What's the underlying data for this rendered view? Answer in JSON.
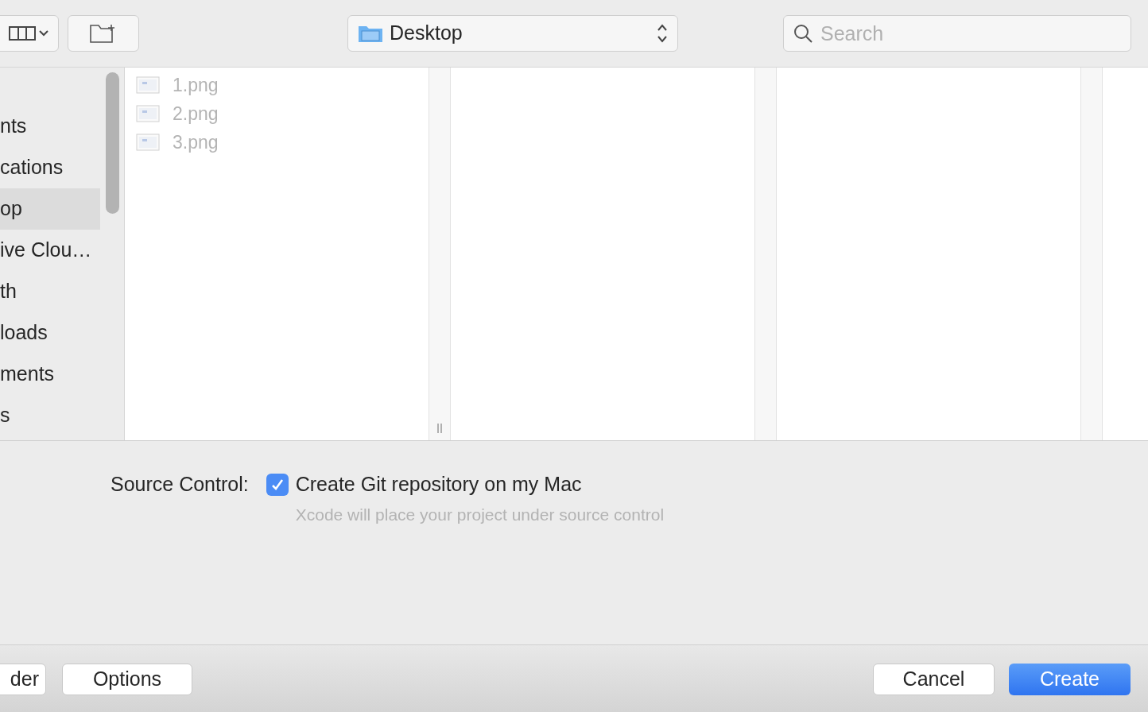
{
  "toolbar": {
    "location": "Desktop",
    "search": {
      "placeholder": "Search"
    }
  },
  "sidebar": {
    "items": [
      {
        "label": "nts",
        "selected": false
      },
      {
        "label": "cations",
        "selected": false
      },
      {
        "label": "op",
        "selected": true
      },
      {
        "label": "ive Clou…",
        "selected": false
      },
      {
        "label": "th",
        "selected": false
      },
      {
        "label": "loads",
        "selected": false
      },
      {
        "label": "ments",
        "selected": false
      },
      {
        "label": "s",
        "selected": false
      }
    ]
  },
  "files": [
    {
      "name": "1.png",
      "disabled": true
    },
    {
      "name": "2.png",
      "disabled": true
    },
    {
      "name": "3.png",
      "disabled": true
    }
  ],
  "source_control": {
    "label": "Source Control:",
    "checkbox": {
      "label": "Create Git repository on my Mac",
      "checked": true
    },
    "hint": "Xcode will place your project under source control"
  },
  "footer": {
    "left_buttons": [
      "der",
      "Options"
    ],
    "right_buttons": [
      {
        "label": "Cancel",
        "kind": "plain"
      },
      {
        "label": "Create",
        "kind": "default"
      }
    ]
  }
}
